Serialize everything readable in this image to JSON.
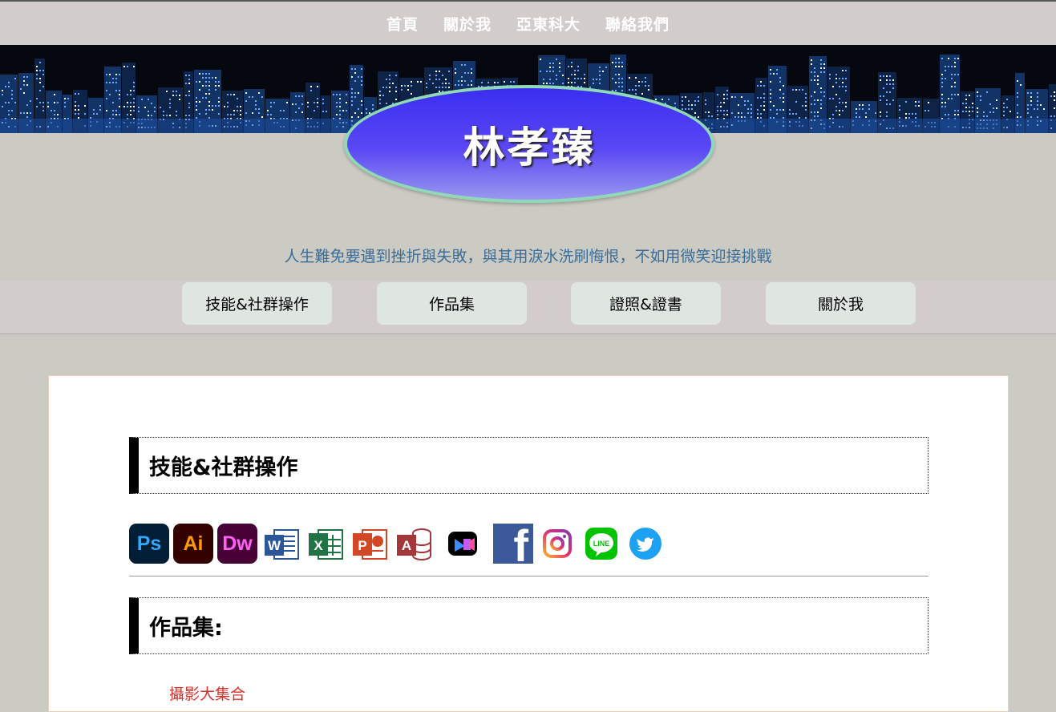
{
  "topnav": {
    "items": [
      "首頁",
      "關於我",
      "亞東科大",
      "聯絡我們"
    ]
  },
  "banner": {
    "name": "林孝臻"
  },
  "motto": "人生難免要遇到挫折與失敗，與其用淚水洗刷悔恨，不如用微笑迎接挑戰",
  "tabs": [
    "技能&社群操作",
    "作品集",
    "證照&證書",
    "關於我"
  ],
  "sections": {
    "skills_title": "技能&社群操作",
    "portfolio_title": "作品集:",
    "portfolio_link": "攝影大集合"
  },
  "icons": [
    {
      "name": "photoshop-icon",
      "label": "Ps",
      "bg": "#001e36",
      "fg": "#31a8ff"
    },
    {
      "name": "illustrator-icon",
      "label": "Ai",
      "bg": "#330000",
      "fg": "#ff9a00"
    },
    {
      "name": "dreamweaver-icon",
      "label": "Dw",
      "bg": "#470137",
      "fg": "#ff61f6"
    },
    {
      "name": "word-icon",
      "label": "W",
      "bg": "#2b579a",
      "fg": "#ffffff"
    },
    {
      "name": "excel-icon",
      "label": "X",
      "bg": "#217346",
      "fg": "#ffffff"
    },
    {
      "name": "powerpoint-icon",
      "label": "P",
      "bg": "#d24726",
      "fg": "#ffffff"
    },
    {
      "name": "access-icon",
      "label": "A",
      "bg": "#a4373a",
      "fg": "#ffffff"
    },
    {
      "name": "video-editor-icon",
      "label": "",
      "bg": "#000000",
      "fg": "#ffffff"
    },
    {
      "name": "facebook-icon",
      "label": "f",
      "bg": "#3b5998",
      "fg": "#ffffff"
    },
    {
      "name": "instagram-icon",
      "label": "",
      "bg": "#ffffff",
      "fg": "#c13584"
    },
    {
      "name": "line-icon",
      "label": "LINE",
      "bg": "#00c300",
      "fg": "#ffffff"
    },
    {
      "name": "twitter-icon",
      "label": "",
      "bg": "#1da1f2",
      "fg": "#ffffff"
    }
  ],
  "colors": {
    "page_bg": "#cbcbc3",
    "nav_bg": "#d3cccc",
    "motto": "#3a6d9a",
    "oval_border": "#8fd9b8",
    "link": "#d9302c"
  }
}
